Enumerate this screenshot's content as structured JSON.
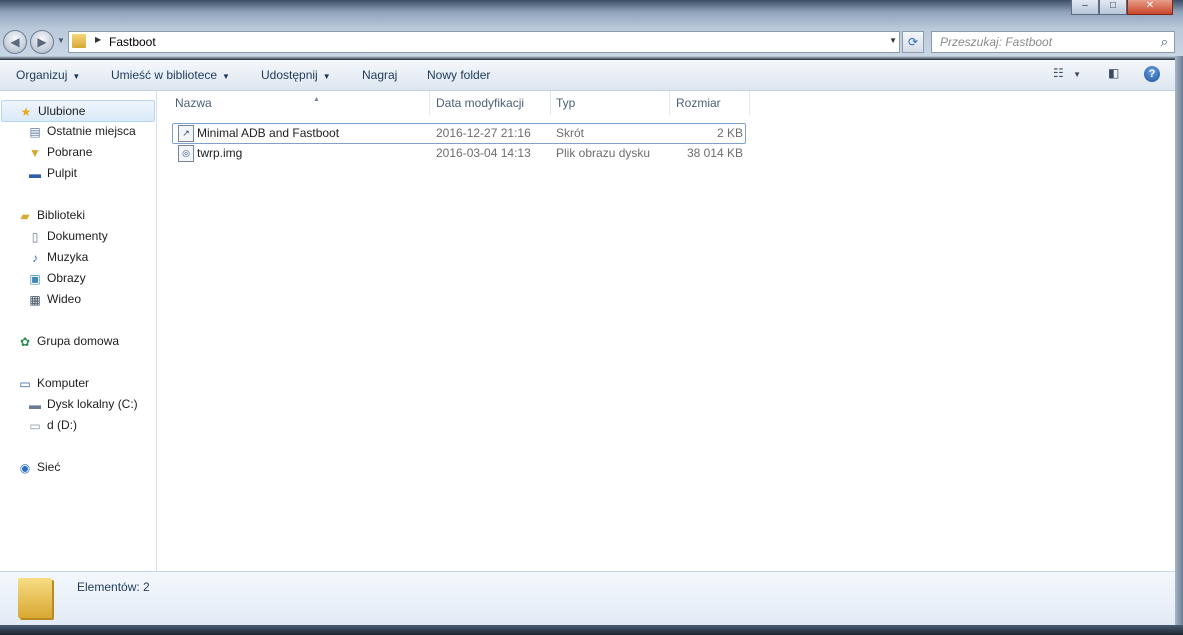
{
  "window": {
    "controls": {
      "minimize": "–",
      "maximize": "□",
      "close": "✕"
    }
  },
  "address": {
    "path": "Fastboot",
    "search_placeholder": "Przeszukaj: Fastboot"
  },
  "toolbar": {
    "organize": "Organizuj",
    "include_in_library": "Umieść w bibliotece",
    "share": "Udostępnij",
    "burn": "Nagraj",
    "new_folder": "Nowy folder"
  },
  "nav": {
    "favorites": "Ulubione",
    "recent": "Ostatnie miejsca",
    "downloads": "Pobrane",
    "desktop": "Pulpit",
    "libraries": "Biblioteki",
    "documents": "Dokumenty",
    "music": "Muzyka",
    "pictures": "Obrazy",
    "videos": "Wideo",
    "homegroup": "Grupa domowa",
    "computer": "Komputer",
    "drive_c": "Dysk lokalny (C:)",
    "drive_d": "d (D:)",
    "network": "Sieć"
  },
  "columns": {
    "name": "Nazwa",
    "date": "Data modyfikacji",
    "type": "Typ",
    "size": "Rozmiar"
  },
  "files": [
    {
      "name": "Minimal ADB and Fastboot",
      "date": "2016-12-27 21:16",
      "type": "Skrót",
      "size": "2 KB",
      "icon": "shortcut-icon"
    },
    {
      "name": "twrp.img",
      "date": "2016-03-04 14:13",
      "type": "Plik obrazu dysku",
      "size": "38 014 KB",
      "icon": "disk-image-icon"
    }
  ],
  "status": {
    "count_text": "Elementów: 2"
  }
}
